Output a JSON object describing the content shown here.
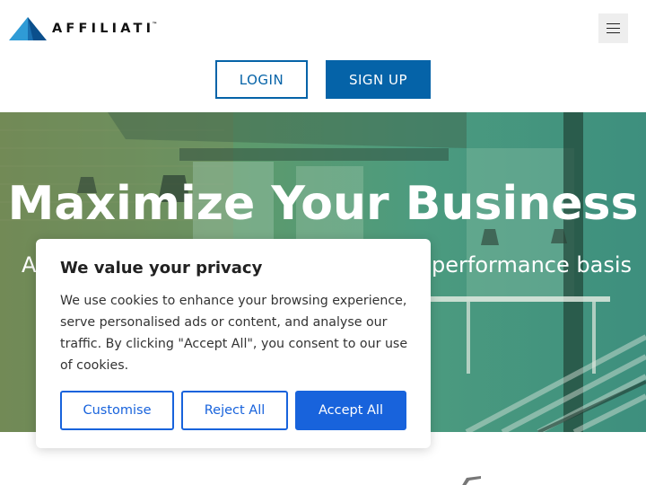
{
  "header": {
    "logo_text": "AFFILIATI",
    "logo_tm": "™",
    "login_label": "LOGIN",
    "signup_label": "SIGN UP"
  },
  "hero": {
    "title": "Maximize Your Business",
    "subtitle_left": "A",
    "subtitle_right": "performance basis"
  },
  "cookie_banner": {
    "title": "We value your privacy",
    "body": "We use cookies to enhance your browsing experience, serve personalised ads or content, and analyse our traffic. By clicking \"Accept All\", you consent to our use of cookies.",
    "customise_label": "Customise",
    "reject_label": "Reject All",
    "accept_label": "Accept All"
  },
  "icons": {
    "logo": "affiliati-triangle-logo-icon",
    "menu": "hamburger-menu-icon"
  },
  "colors": {
    "brand_blue": "#0563a8",
    "logo_light_blue": "#2f9bd6",
    "cookie_blue": "#1863dc",
    "hero_tint": "#4c9b7f"
  }
}
